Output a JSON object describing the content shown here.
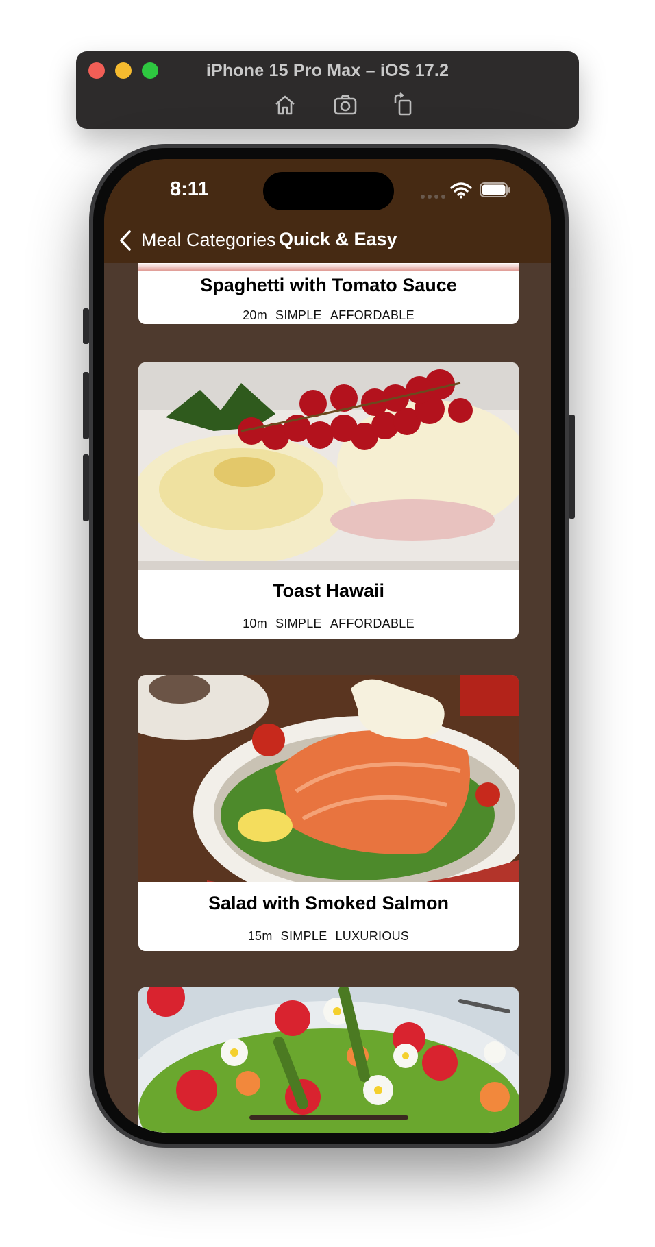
{
  "simulator": {
    "title": "iPhone 15 Pro Max – iOS 17.2",
    "tools": [
      "home-icon",
      "screenshot-camera-icon",
      "rotate-icon"
    ]
  },
  "status_bar": {
    "time": "8:11"
  },
  "nav": {
    "back_label": "Meal Categories",
    "title": "Quick & Easy"
  },
  "meals": [
    {
      "title": "Spaghetti with Tomato Sauce",
      "duration": "20m",
      "complexity": "SIMPLE",
      "affordability": "AFFORDABLE",
      "image_desc": "spaghetti"
    },
    {
      "title": "Toast Hawaii",
      "duration": "10m",
      "complexity": "SIMPLE",
      "affordability": "AFFORDABLE",
      "image_desc": "toast with cheese and red currants"
    },
    {
      "title": "Salad with Smoked Salmon",
      "duration": "15m",
      "complexity": "SIMPLE",
      "affordability": "LUXURIOUS",
      "image_desc": "smoked salmon salad"
    },
    {
      "title": "",
      "image_desc": "asparagus and strawberry salad"
    }
  ],
  "colors": {
    "nav_background": "#462a13",
    "list_background": "#4e3a2e",
    "card_background": "#ffffff"
  }
}
